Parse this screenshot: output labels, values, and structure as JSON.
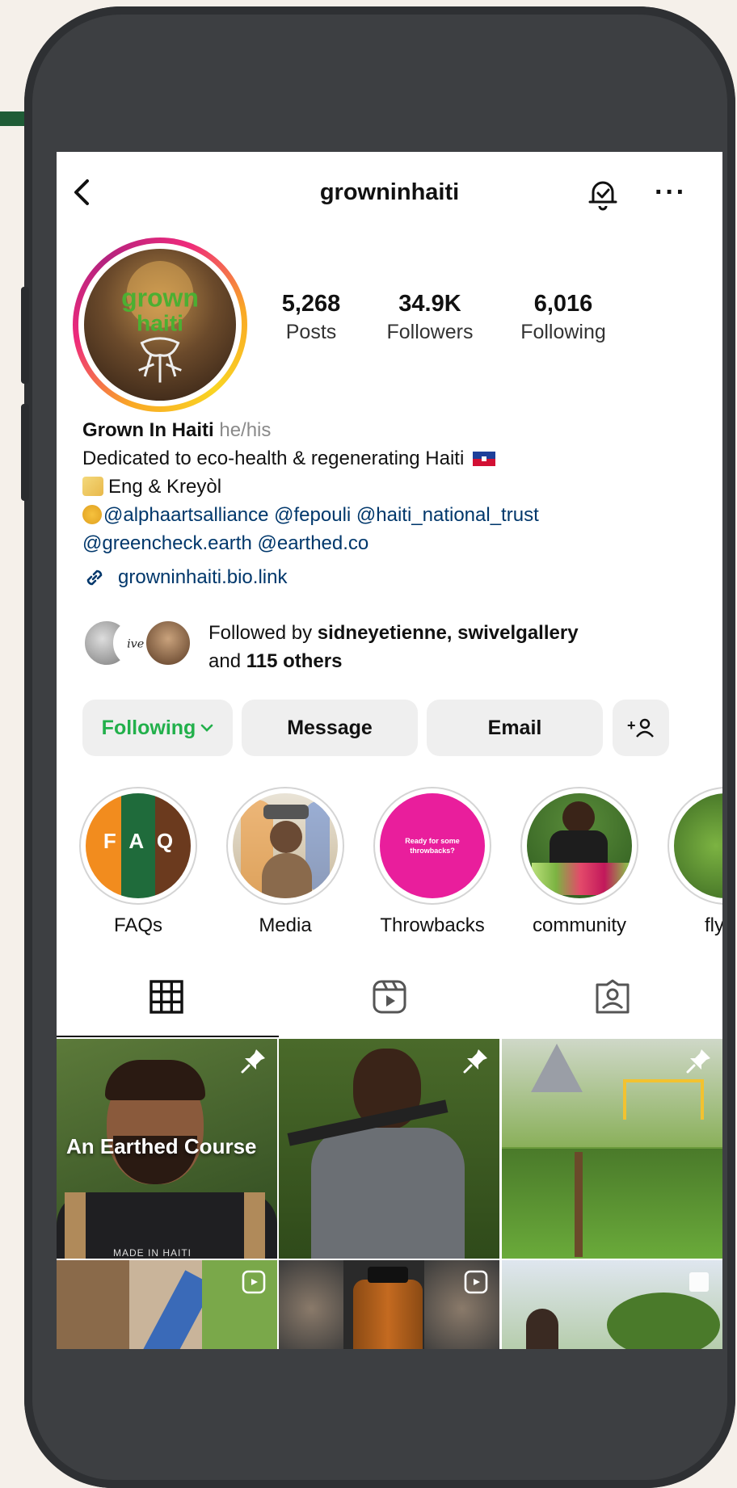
{
  "header": {
    "username": "growninhaiti"
  },
  "profile": {
    "avatar_text": "grown haiti",
    "stats": [
      {
        "value": "5,268",
        "label": "Posts"
      },
      {
        "value": "34.9K",
        "label": "Followers"
      },
      {
        "value": "6,016",
        "label": "Following"
      }
    ],
    "name": "Grown In Haiti",
    "pronouns": "he/his",
    "bio_line1": "Dedicated to eco-health & regenerating Haiti",
    "bio_line2": "Eng & Kreyòl",
    "mentions_line1": "@alphaartsalliance @fepouli @haiti_national_trust",
    "mentions_line2": "@greencheck.earth @earthed.co",
    "link": "growninhaiti.bio.link",
    "followed_prefix": "Followed by",
    "followed_names": "sidneyetienne, swivelgallery",
    "followed_and": "and",
    "followed_others": "115 others"
  },
  "actions": {
    "following_label": "Following",
    "message_label": "Message",
    "email_label": "Email"
  },
  "highlights": [
    {
      "label": "FAQs",
      "faq_letters": [
        "F",
        "A",
        "Q"
      ]
    },
    {
      "label": "Media"
    },
    {
      "label": "Throwbacks",
      "caption": "Ready for some throwbacks?"
    },
    {
      "label": "community"
    },
    {
      "label": "flyi"
    }
  ],
  "grid": {
    "post1_caption": "An Earthed Course",
    "post1_shirt": "MADE IN HAITI"
  },
  "colors": {
    "following_green": "#22b04b",
    "link_blue": "#00376b",
    "accent_bar": "#1f5c36",
    "throwbacks_pink": "#e91e9c"
  }
}
